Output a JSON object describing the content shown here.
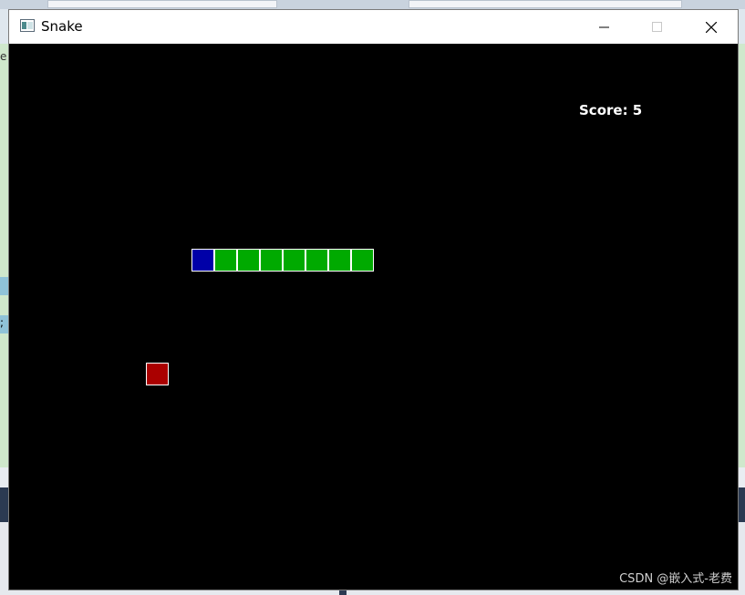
{
  "window": {
    "title": "Snake",
    "controls": [
      "minimize-icon",
      "maximize-icon",
      "close-icon"
    ]
  },
  "game": {
    "score_text": "Score: 5",
    "score": 5,
    "colors": {
      "background": "#000000",
      "head": "#0000a8",
      "body": "#00aa00",
      "food": "#aa0000",
      "cell_border": "#ffffff"
    }
  },
  "watermark": "CSDN @嵌入式-老费",
  "background_fragments": {
    "left_text_1": "e",
    "left_text_2": ";"
  }
}
